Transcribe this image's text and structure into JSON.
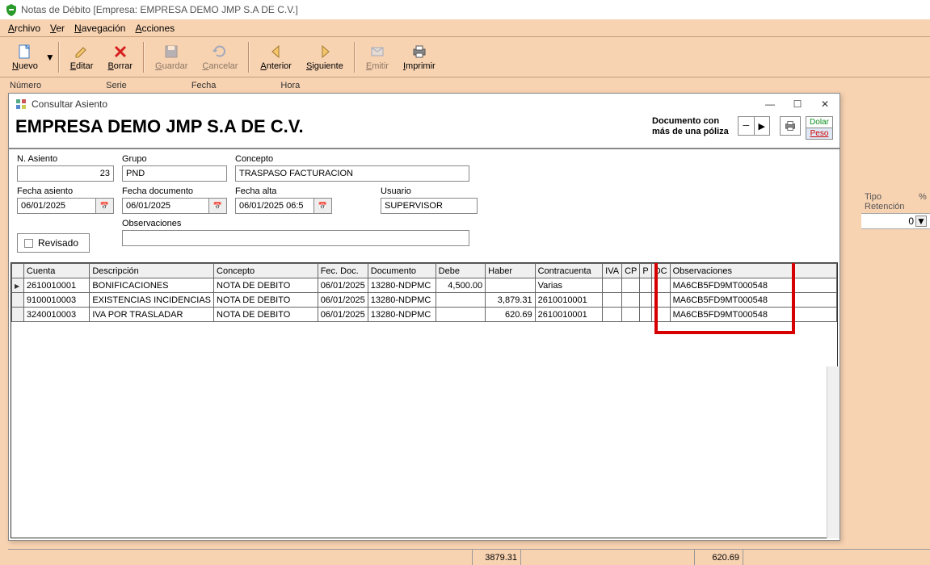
{
  "main": {
    "title": "Notas de Débito [Empresa: EMPRESA DEMO JMP S.A DE C.V.]"
  },
  "menu": {
    "archivo": "Archivo",
    "ver": "Ver",
    "navegacion": "Navegación",
    "acciones": "Acciones"
  },
  "toolbar": {
    "nuevo": "Nuevo",
    "editar": "Editar",
    "borrar": "Borrar",
    "guardar": "Guardar",
    "cancelar": "Cancelar",
    "anterior": "Anterior",
    "siguiente": "Siguiente",
    "emitir": "Emitir",
    "imprimir": "Imprimir"
  },
  "bg": {
    "numero": "Número",
    "serie": "Serie",
    "fecha": "Fecha",
    "hora": "Hora",
    "tipo_ret": "Tipo Retención",
    "pct": "%",
    "zero": "0",
    "bottom_a": "3879.31",
    "bottom_b": "620.69"
  },
  "modal": {
    "title": "Consultar Asiento",
    "company": "EMPRESA DEMO JMP S.A DE C.V.",
    "doc_note": "Documento con más de una póliza",
    "dolar": "Dolar",
    "peso": "Peso",
    "labels": {
      "n_asiento": "N. Asiento",
      "grupo": "Grupo",
      "concepto": "Concepto",
      "fecha_asiento": "Fecha asiento",
      "fecha_documento": "Fecha documento",
      "fecha_alta": "Fecha alta",
      "usuario": "Usuario",
      "revisado": "Revisado",
      "observaciones": "Observaciones"
    },
    "values": {
      "n_asiento": "23",
      "grupo": "PND",
      "concepto": "TRASPASO FACTURACION",
      "fecha_asiento": "06/01/2025",
      "fecha_documento": "06/01/2025",
      "fecha_alta": "06/01/2025 06:5",
      "usuario": "SUPERVISOR",
      "observaciones": ""
    }
  },
  "grid": {
    "headers": {
      "cuenta": "Cuenta",
      "descripcion": "Descripción",
      "concepto": "Concepto",
      "fec_doc": "Fec. Doc.",
      "documento": "Documento",
      "debe": "Debe",
      "haber": "Haber",
      "contracuenta": "Contracuenta",
      "iva": "IVA",
      "cp": "CP",
      "p": "P",
      "dc": "DC",
      "observaciones": "Observaciones"
    },
    "rows": [
      {
        "cuenta": "2610010001",
        "descripcion": "BONIFICACIONES",
        "concepto": "NOTA DE DEBITO",
        "fec_doc": "06/01/2025",
        "documento": "13280-NDPMC",
        "debe": "4,500.00",
        "haber": "",
        "contracuenta": "Varias",
        "iva": "",
        "cp": "",
        "p": "",
        "dc": "",
        "obs": "MA6CB5FD9MT000548"
      },
      {
        "cuenta": "9100010003",
        "descripcion": "EXISTENCIAS INCIDENCIAS",
        "concepto": "NOTA DE DEBITO",
        "fec_doc": "06/01/2025",
        "documento": "13280-NDPMC",
        "debe": "",
        "haber": "3,879.31",
        "contracuenta": "2610010001",
        "iva": "",
        "cp": "",
        "p": "",
        "dc": "",
        "obs": "MA6CB5FD9MT000548"
      },
      {
        "cuenta": "3240010003",
        "descripcion": "IVA POR TRASLADAR",
        "concepto": "NOTA DE DEBITO",
        "fec_doc": "06/01/2025",
        "documento": "13280-NDPMC",
        "debe": "",
        "haber": "620.69",
        "contracuenta": "2610010001",
        "iva": "",
        "cp": "",
        "p": "",
        "dc": "",
        "obs": "MA6CB5FD9MT000548"
      }
    ]
  }
}
